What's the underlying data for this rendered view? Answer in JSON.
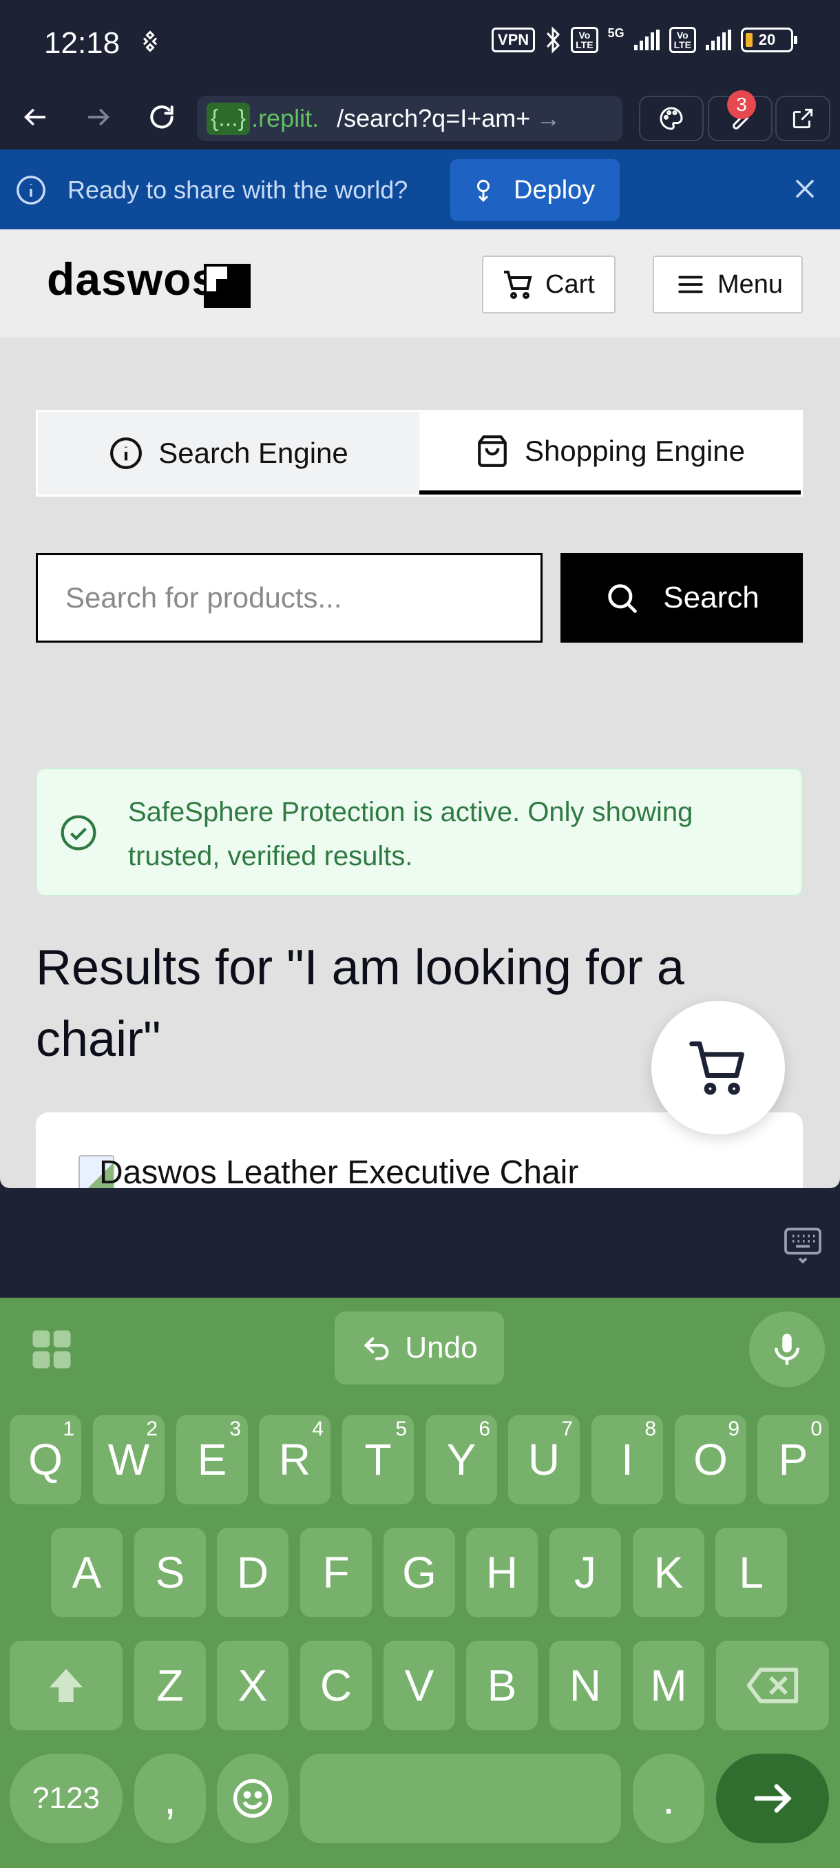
{
  "status_bar": {
    "time": "12:18",
    "vpn": "VPN",
    "volte1": "Vo LTE",
    "network": "5G",
    "volte2": "Vo LTE",
    "battery": "20"
  },
  "browser": {
    "url_chip": "{...}",
    "url_host": ".replit.",
    "url_path": "/search?q=I+am+",
    "notification_count": "3"
  },
  "deploy_banner": {
    "message": "Ready to share with the world?",
    "button_label": "Deploy"
  },
  "site": {
    "logo_text": "daswos",
    "cart_label": "Cart",
    "menu_label": "Menu"
  },
  "tabs": [
    {
      "label": "Search Engine",
      "active": false
    },
    {
      "label": "Shopping Engine",
      "active": true
    }
  ],
  "search": {
    "placeholder": "Search for products...",
    "button_label": "Search"
  },
  "safesphere": {
    "message": "SafeSphere Protection is active. Only showing trusted, verified results."
  },
  "results": {
    "title": "Results for \"I am looking for a chair\"",
    "products": [
      {
        "name": "Daswos Leather Executive Chair"
      }
    ]
  },
  "keyboard": {
    "undo_label": "Undo",
    "row1": [
      {
        "key": "Q",
        "hint": "1"
      },
      {
        "key": "W",
        "hint": "2"
      },
      {
        "key": "E",
        "hint": "3"
      },
      {
        "key": "R",
        "hint": "4"
      },
      {
        "key": "T",
        "hint": "5"
      },
      {
        "key": "Y",
        "hint": "6"
      },
      {
        "key": "U",
        "hint": "7"
      },
      {
        "key": "I",
        "hint": "8"
      },
      {
        "key": "O",
        "hint": "9"
      },
      {
        "key": "P",
        "hint": "0"
      }
    ],
    "row2": [
      "A",
      "S",
      "D",
      "F",
      "G",
      "H",
      "J",
      "K",
      "L"
    ],
    "row3": [
      "Z",
      "X",
      "C",
      "V",
      "B",
      "N",
      "M"
    ],
    "symbols_label": "?123",
    "comma": ",",
    "period": "."
  },
  "colors": {
    "deploy_banner": "#0d4a9a",
    "keyboard": "#5d9c52",
    "safe_text": "#2f7a43"
  }
}
